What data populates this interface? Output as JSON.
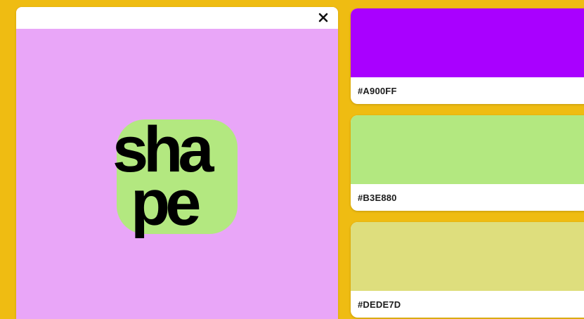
{
  "preview": {
    "close_icon": "close-icon",
    "background_color": "#E9A6F8",
    "logo": {
      "line1": "sha",
      "line2": "pe",
      "tile_color": "#B3E880"
    }
  },
  "palette": [
    {
      "hex": "#A900FF",
      "color": "#A900FF"
    },
    {
      "hex": "#B3E880",
      "color": "#B3E880"
    },
    {
      "hex": "#DEDE7D",
      "color": "#DEDE7D"
    }
  ],
  "page_background": "#EFBC12"
}
